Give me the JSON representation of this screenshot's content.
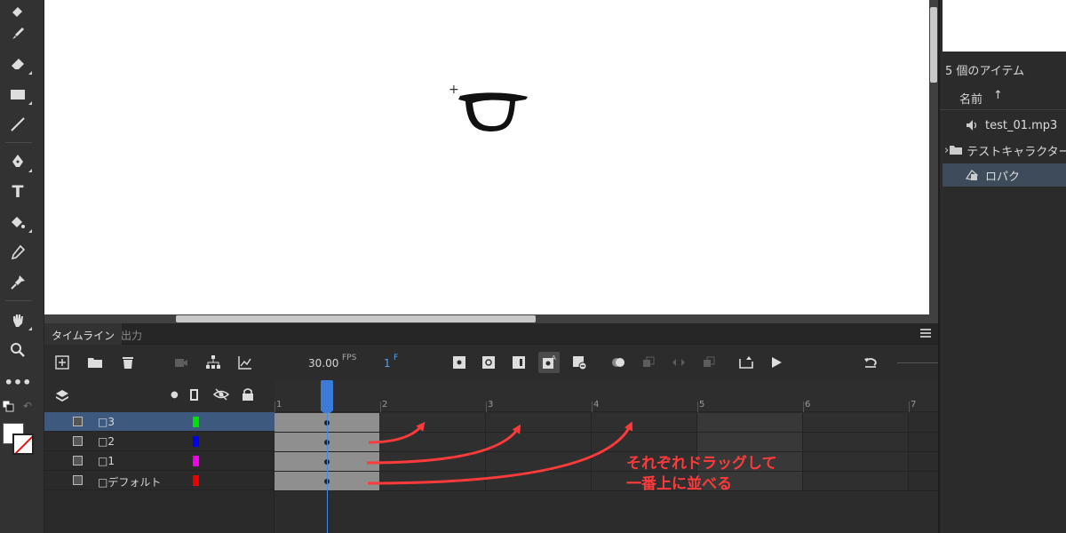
{
  "stage": {
    "cursor_symbol": "+"
  },
  "library": {
    "count_label": "5 個のアイテム",
    "sort_label": "名前",
    "sort_icon": "arrow-up-icon",
    "items": [
      {
        "label": "test_01.mp3",
        "icon": "sound-icon"
      },
      {
        "label": "テストキャラクター",
        "icon": "folder-icon"
      },
      {
        "label": "ロパク",
        "icon": "graphic-symbol-icon"
      }
    ]
  },
  "timeline": {
    "tabs": {
      "timeline": "タイムライン",
      "output": "出力"
    },
    "fps_value": "30.00",
    "fps_unit": "FPS",
    "current_frame": "1",
    "frame_unit": "F",
    "ruler_labels": [
      "1",
      "2",
      "3",
      "4",
      "5",
      "6",
      "7"
    ],
    "layers": [
      {
        "name": "□3",
        "color": "#00e000",
        "selected": true
      },
      {
        "name": "□2",
        "color": "#0000ee",
        "selected": false
      },
      {
        "name": "□1",
        "color": "#ee00ee",
        "selected": false
      },
      {
        "name": "□デフォルト",
        "color": "#ee0000",
        "selected": false
      }
    ]
  },
  "annotation": {
    "line1": "それぞれドラッグして",
    "line2": "一番上に並べる",
    "color": "#ff3a3a"
  }
}
